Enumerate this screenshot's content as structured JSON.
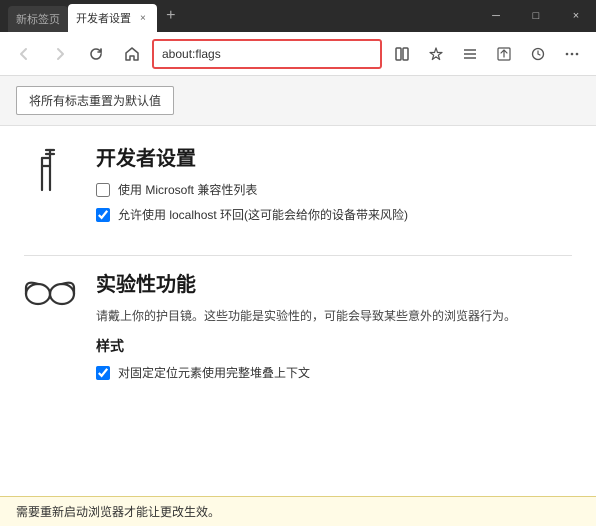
{
  "titlebar": {
    "tab_inactive_label": "新标签页",
    "tab_active_label": "开发者设置",
    "tab_close": "×",
    "new_tab": "+",
    "window_minimize": "─",
    "window_maximize": "□",
    "window_close": "×"
  },
  "navbar": {
    "back_title": "后退",
    "forward_title": "前进",
    "refresh_title": "刷新",
    "home_title": "主页",
    "address_value": "about:flags",
    "reading_mode": "📖",
    "favorites": "☆",
    "hub": "≡",
    "share": "✎",
    "notes": "🔔",
    "more": "···"
  },
  "reset_button": {
    "label": "将所有标志重置为默认值"
  },
  "developer_section": {
    "title": "开发者设置",
    "checkbox1_label": "使用 Microsoft 兼容性列表",
    "checkbox1_checked": false,
    "checkbox2_label": "允许使用 localhost 环回(这可能会给你的设备带来风险)",
    "checkbox2_checked": true
  },
  "experimental_section": {
    "title": "实验性功能",
    "description": "请戴上你的护目镜。这些功能是实验性的，可能会导致某些意外的浏览器行为。",
    "subsection_title": "样式",
    "checkbox1_label": "对固定定位元素使用完整堆叠上下文",
    "checkbox1_checked": true
  },
  "status_bar": {
    "message": "需要重新启动浏览器才能让更改生效。"
  }
}
